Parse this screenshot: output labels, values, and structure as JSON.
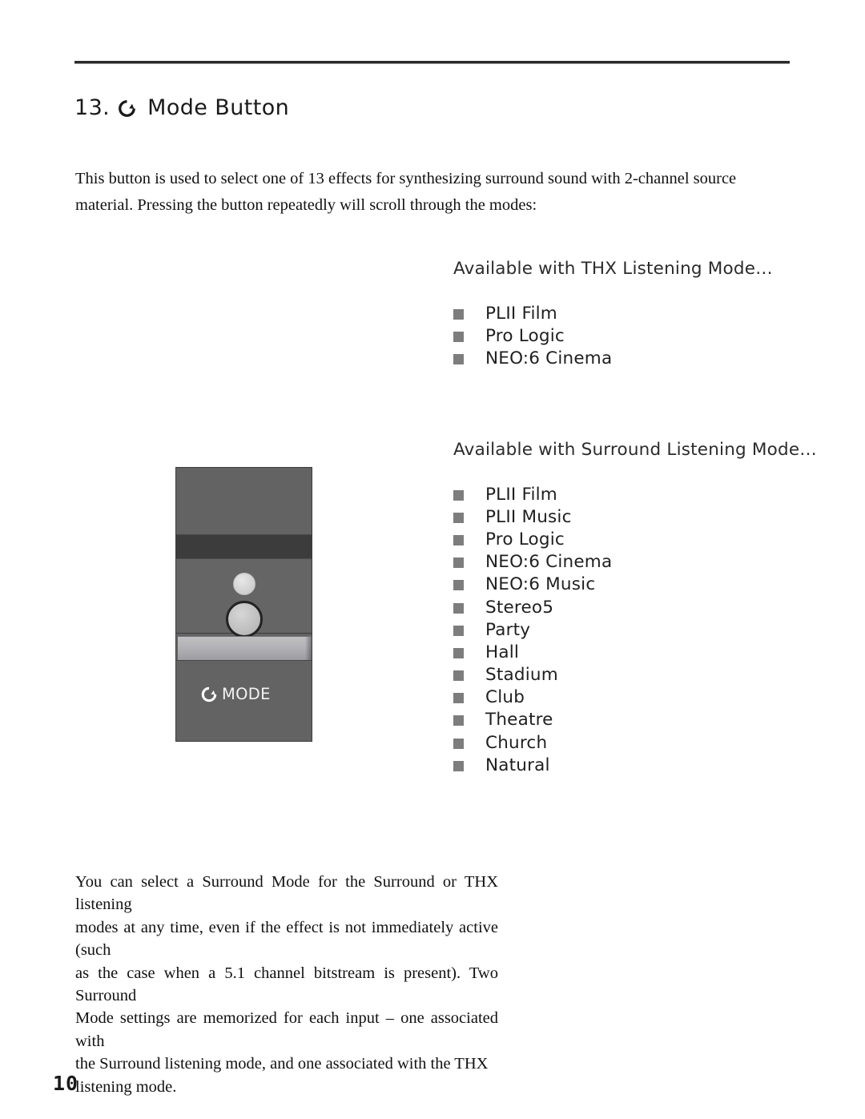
{
  "document": {
    "section_number": "13.",
    "section_icon": "cycle-arrow-icon",
    "section_title": "Mode Button",
    "page_number": "10"
  },
  "intro_paragraph": "This button is used to select one of 13 effects for synthesizing surround sound with 2-channel source material. Pressing the button repeatedly will scroll through the modes:",
  "thx_list": {
    "title": "Available with THX Listening Mode…",
    "items": [
      "PLII Film",
      "Pro Logic",
      "NEO:6 Cinema"
    ]
  },
  "surround_list": {
    "title": "Available with Surround Listening Mode…",
    "items": [
      "PLII Film",
      "PLII Music",
      "Pro Logic",
      "NEO:6 Cinema",
      "NEO:6 Music",
      "Stereo5",
      "Party",
      "Hall",
      "Stadium",
      "Club",
      "Theatre",
      "Church",
      "Natural"
    ]
  },
  "remote": {
    "legend_icon": "cycle-arrow-icon",
    "legend_label": "MODE",
    "body_color": "#646464",
    "dark_band_color": "#3c3c3c",
    "light_bar_color": "#b2b2b6",
    "small_button_color": "#d2d2d2",
    "large_button_color": "#bdbdbd"
  },
  "closing_paragraph": {
    "lines": [
      "You can select a Surround Mode for the Surround or THX listening",
      "modes at any time, even if the effect is not immediately active (such",
      "as the case when a 5.1 channel bitstream is present).  Two Surround",
      "Mode settings are memorized for each input – one associated with",
      "the Surround listening mode, and one associated with the THX",
      "listening mode."
    ]
  },
  "colors": {
    "rule": "#2a2a2a",
    "bullet": "#7d7d7d",
    "text": "#111111"
  }
}
